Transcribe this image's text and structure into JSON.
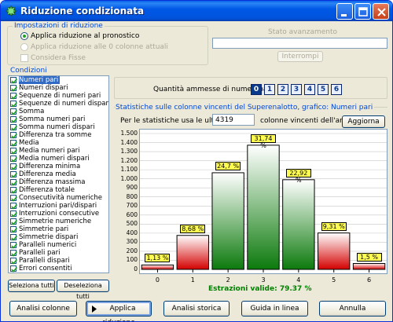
{
  "window": {
    "title": "Riduzione condizionata"
  },
  "settings": {
    "legend": "Impostazioni di riduzione",
    "options": [
      "Applica riduzione al pronostico",
      "Applica riduzione alle 0 colonne attuali"
    ],
    "consider_fixed": "Considera Fisse"
  },
  "progress": {
    "legend": "Stato avanzamento",
    "value": 0,
    "interrupt_label": "Interrompi"
  },
  "conditions": {
    "legend": "Condizioni",
    "items": [
      "Numeri pari",
      "Numeri dispari",
      "Sequenze di numeri pari",
      "Sequenze di numeri dispari",
      "Somma",
      "Somma numeri pari",
      "Somma numeri dispari",
      "Differenza tra somme",
      "Media",
      "Media numeri pari",
      "Media numeri dispari",
      "Differenza minima",
      "Differenza media",
      "Differenza massima",
      "Differenza totale",
      "Consecutività numeriche",
      "Interruzioni pari/dispari",
      "Interruzioni consecutive",
      "Simmetrie numeriche",
      "Simmetrie pari",
      "Simmetrie dispari",
      "Paralleli numerici",
      "Paralleli pari",
      "Paralleli dispari",
      "Errori consentiti"
    ],
    "select_all": "Seleziona tutti",
    "deselect_all": "Deseleziona tutti"
  },
  "allowed": {
    "label": "Quantità ammesse di numeri pari:",
    "numbers": [
      "0",
      "1",
      "2",
      "3",
      "4",
      "5",
      "6"
    ],
    "colors": [
      "dark",
      "light",
      "light",
      "light",
      "light",
      "light",
      "light"
    ]
  },
  "stats": {
    "legend": "Statistiche sulle colonne vincenti del Superenalotto, grafico: Numeri pari",
    "prefix": "Per le statistiche usa le ultime",
    "count": "4319",
    "suffix": "colonne vincenti dell'archivio",
    "update": "Aggiorna",
    "valid": "Estrazioni valide: 79.37 %"
  },
  "chart_data": {
    "type": "bar",
    "categories": [
      "0",
      "1",
      "2",
      "3",
      "4",
      "5",
      "6"
    ],
    "values": [
      49,
      375,
      1067,
      1371,
      990,
      402,
      65
    ],
    "data_labels": [
      "1,13 %",
      "8,68 %",
      "24,7 %",
      "31,74 %",
      "22,92 %",
      "9,31 %",
      "1,5 %"
    ],
    "colors": [
      "#e01010",
      "#e01010",
      "#1a8a1a",
      "#1a8a1a",
      "#1a8a1a",
      "#e01010",
      "#e01010"
    ],
    "ylim": [
      0,
      1500
    ],
    "yticks": [
      0,
      100,
      200,
      300,
      400,
      500,
      600,
      700,
      800,
      900,
      1000,
      1100,
      1200,
      1300,
      1400,
      1500
    ],
    "ytick_labels": [
      "0",
      "100",
      "200",
      "300",
      "400",
      "500",
      "600",
      "700",
      "800",
      "900",
      "1.000",
      "1.100",
      "1.200",
      "1.300",
      "1.400",
      "1.500"
    ],
    "grid": true
  },
  "buttons": {
    "analyze_columns": "Analisi colonne",
    "apply": "Applica riduzione",
    "history": "Analisi storica",
    "guide": "Guida in linea",
    "cancel": "Annulla"
  }
}
